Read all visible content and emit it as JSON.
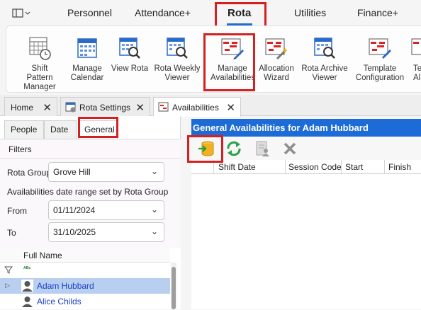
{
  "menu": {
    "items": [
      "Personnel",
      "Attendance+",
      "Rota",
      "Utilities",
      "Finance+"
    ],
    "active": "Rota"
  },
  "ribbon": {
    "buttons": [
      {
        "label": "Shift Pattern Manager",
        "icon": "shift-pattern-icon"
      },
      {
        "label": "Manage Calendar",
        "icon": "calendar-icon"
      },
      {
        "label": "View Rota",
        "icon": "view-rota-icon"
      },
      {
        "label": "Rota Weekly Viewer",
        "icon": "weekly-viewer-icon"
      },
      {
        "label": "Manage Availabilities",
        "icon": "availabilities-icon"
      },
      {
        "label": "Allocation Wizard",
        "icon": "wizard-icon"
      },
      {
        "label": "Rota Archive Viewer",
        "icon": "archive-icon"
      },
      {
        "label": "Template Configuration",
        "icon": "template-icon"
      },
      {
        "label": "Te Allo",
        "icon": "template-allocation-icon"
      }
    ]
  },
  "doc_tabs": [
    {
      "label": "Home"
    },
    {
      "label": "Rota Settings"
    },
    {
      "label": "Availabilities"
    }
  ],
  "left": {
    "sub_tabs": [
      "People",
      "Date",
      "General"
    ],
    "active_sub_tab": "General",
    "filters_title": "Filters",
    "rota_group_label": "Rota Group",
    "rota_group_value": "Grove Hill",
    "range_note": "Availabilities date range set by Rota Group",
    "from_label": "From",
    "from_value": "01/11/2024",
    "to_label": "To",
    "to_value": "31/10/2025",
    "grid_header": "Full Name",
    "filter_row_icon": "abc-filter-icon",
    "people": [
      "Adam Hubbard",
      "Alice Childs"
    ],
    "selected_person": "Adam Hubbard"
  },
  "right": {
    "title": "General Availabilities for Adam Hubbard",
    "toolbar": [
      "import-icon",
      "refresh-icon",
      "report-icon",
      "delete-icon"
    ],
    "columns": [
      "Shift Date",
      "Session Code",
      "Start",
      "Finish"
    ]
  },
  "colors": {
    "accent": "#1d6bd6",
    "highlight_box": "#d42020",
    "selected_row": "#b9cff0"
  }
}
